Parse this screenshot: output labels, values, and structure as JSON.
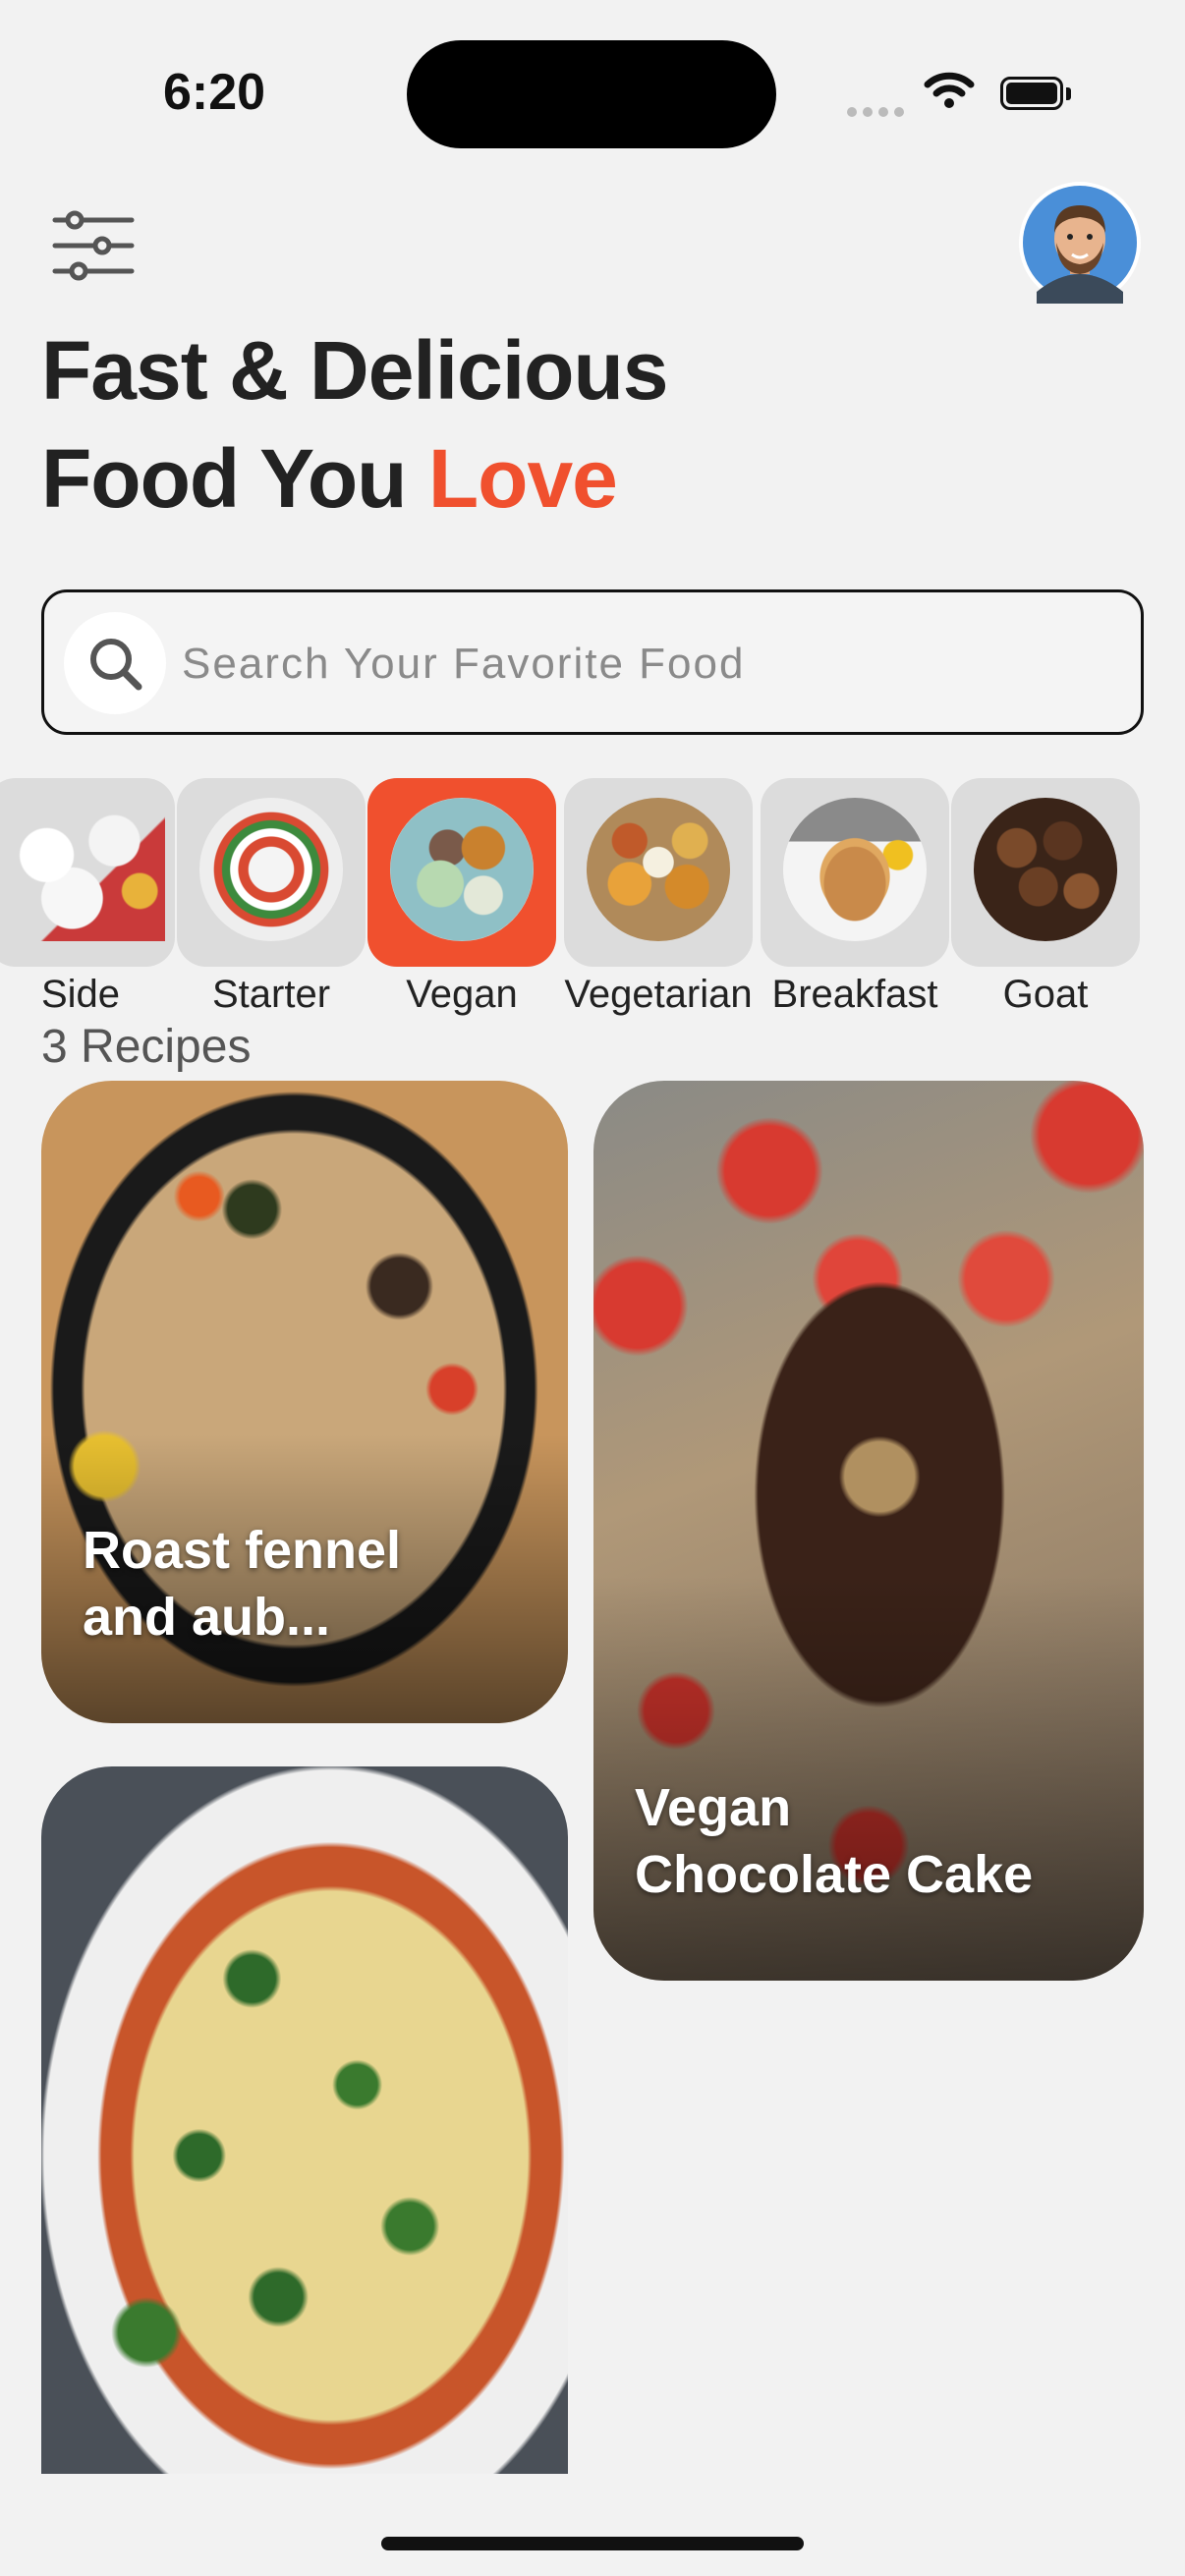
{
  "status_bar": {
    "time": "6:20"
  },
  "header": {
    "title_line1": "Fast & Delicious",
    "title_line2_prefix": "Food You ",
    "title_line2_accent": "Love"
  },
  "search": {
    "placeholder": "Search Your Favorite Food",
    "value": ""
  },
  "categories": [
    {
      "label": "Side",
      "selected": false
    },
    {
      "label": "Starter",
      "selected": false
    },
    {
      "label": "Vegan",
      "selected": true
    },
    {
      "label": "Vegetarian",
      "selected": false
    },
    {
      "label": "Breakfast",
      "selected": false
    },
    {
      "label": "Goat",
      "selected": false
    }
  ],
  "results": {
    "count_label": "3 Recipes"
  },
  "recipes": [
    {
      "title_line1": "Roast fennel",
      "title_line2": "and aub..."
    },
    {
      "title_line1": "Vegan",
      "title_line2": "Chocolate Cake"
    },
    {
      "title_line1": "",
      "title_line2": ""
    }
  ],
  "colors": {
    "accent": "#f0502e",
    "background": "#f2f2f2",
    "tile": "#dcdcdc"
  },
  "icons": {
    "filter": "sliders-icon",
    "search": "search-icon",
    "avatar": "bearded-man-avatar",
    "wifi": "wifi-icon",
    "battery": "battery-icon",
    "signal": "signal-dots-icon"
  }
}
